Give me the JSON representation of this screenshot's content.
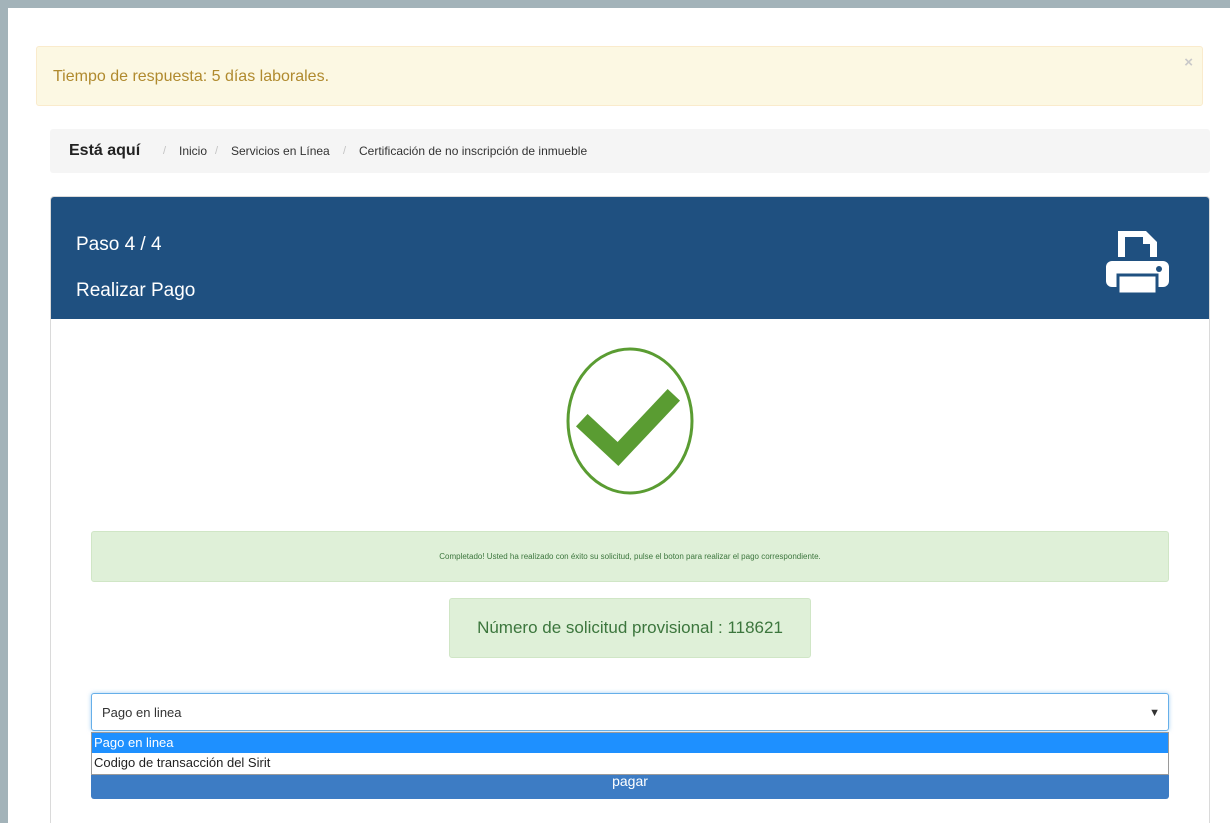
{
  "alert": {
    "message": "Tiempo de respuesta: 5 días laborales.",
    "close_label": "×"
  },
  "breadcrumb": {
    "here": "Está aquí",
    "separator": "/",
    "items": [
      "Inicio",
      "Servicios en Línea",
      "Certificación de no inscripción de inmueble"
    ]
  },
  "panel": {
    "step": "Paso 4 / 4",
    "title": "Realizar Pago",
    "print_icon": "printer-icon"
  },
  "success": {
    "icon": "check-circle-icon",
    "message": "Completado! Usted ha realizado con éxito su solicitud, pulse el boton para realizar el pago correspondiente.",
    "request_number": "Número de solicitud provisional : 118621"
  },
  "payment_select": {
    "value": "Pago en linea",
    "arrow": "▼",
    "options": [
      "Pago en linea",
      "Codigo de transacción del Sirit"
    ]
  },
  "pay_button": {
    "label": "pagar"
  },
  "colors": {
    "header": "#1f5080",
    "success_bg": "#dff0d8",
    "success_text": "#3c763d",
    "check": "#5a9c32",
    "accent": "#3d7cc4"
  }
}
